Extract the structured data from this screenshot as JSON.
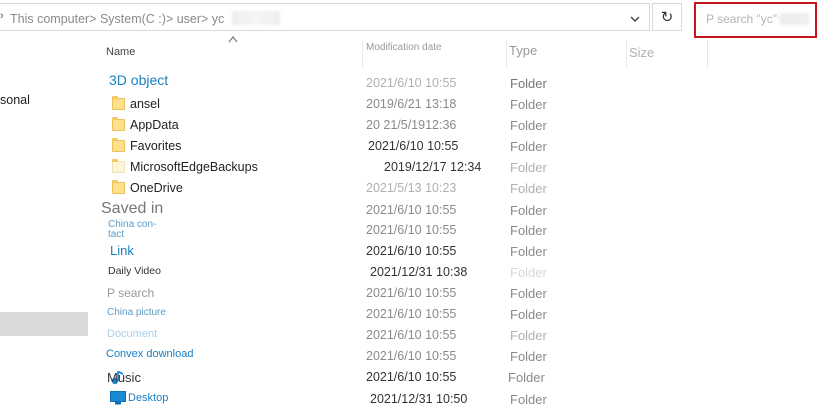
{
  "address": {
    "path": "This computer> System(C :)> user> yc",
    "dropdown_icon": "chevron-down-icon",
    "refresh_icon": "refresh-icon"
  },
  "search": {
    "placeholder": "P search \"yc\""
  },
  "nav": {
    "partial_item": "sonal"
  },
  "columns": {
    "name": "Name",
    "modified": "Modification date",
    "type": "Type",
    "size": "Size"
  },
  "colors": {
    "highlight_border": "#c8161d",
    "link_blue": "#1a7fc1",
    "folder_yellow": "#ffe08a"
  },
  "rows": [
    {
      "name": "3D object",
      "date": "2021/6/10 10:55",
      "type": "Folder"
    },
    {
      "name": "ansel",
      "date": "2019/6/21 13:18",
      "type": "Folder"
    },
    {
      "name": "AppData",
      "date": "20 21/5/1912:36",
      "type": "Folder"
    },
    {
      "name": "Favorites",
      "date": "2021/6/10 10:55",
      "type": "Folder"
    },
    {
      "name": "MicrosoftEdgeBackups",
      "date": "2019/12/17 12:34",
      "type": "Folder"
    },
    {
      "name": "OneDrive",
      "date": "2021/5/13 10:23",
      "type": "Folder"
    },
    {
      "name": "Saved in",
      "date": "2021/6/10 10:55",
      "type": "Folder"
    },
    {
      "name": "China con-\ntact",
      "date": "2021/6/10 10:55",
      "type": "Folder"
    },
    {
      "name": "Link",
      "date": "2021/6/10 10:55",
      "type": "Folder"
    },
    {
      "name": "Daily Video",
      "date": "2021/12/31 10:38",
      "type": "Folder"
    },
    {
      "name": "P search",
      "date": "2021/6/10 10:55",
      "type": "Folder"
    },
    {
      "name": "China picture",
      "date": "2021/6/10 10:55",
      "type": "Folder"
    },
    {
      "name": "Document",
      "date": "2021/6/10 10:55",
      "type": "Folder"
    },
    {
      "name": "Convex download",
      "date": "2021/6/10 10:55",
      "type": "Folder"
    },
    {
      "name": "Music",
      "date": "2021/6/10 10:55",
      "type": "Folder"
    },
    {
      "name": "Desktop",
      "date": "2021/12/31 10:50",
      "type": "Folder"
    }
  ]
}
